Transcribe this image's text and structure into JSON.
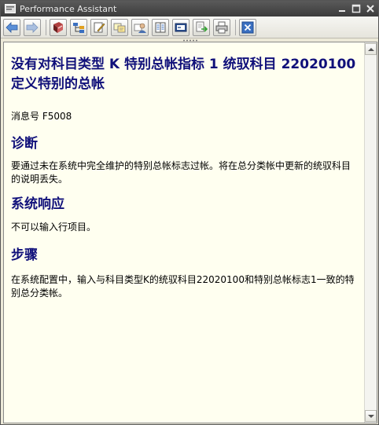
{
  "window": {
    "title": "Performance Assistant"
  },
  "toolbar": {
    "buttons": [
      {
        "name": "back-icon"
      },
      {
        "name": "forward-icon"
      },
      {
        "name": "book-icon"
      },
      {
        "name": "structure-icon"
      },
      {
        "name": "edit-icon"
      },
      {
        "name": "note-icon"
      },
      {
        "name": "user-icon"
      },
      {
        "name": "glossary-icon"
      },
      {
        "name": "display-icon"
      },
      {
        "name": "export-icon"
      },
      {
        "name": "print-icon"
      },
      {
        "name": "close-icon"
      }
    ]
  },
  "doc": {
    "title": "没有对科目类型 K 特别总帐指标 1 统驭科目 22020100 定义特别的总帐",
    "message_number": "消息号 F5008",
    "sections": [
      {
        "heading": "诊断",
        "text": "要通过未在系统中完全维护的特别总帐标志过帐。将在总分类帐中更新的统驭科目的说明丢失。"
      },
      {
        "heading": "系统响应",
        "text": "不可以输入行项目。"
      },
      {
        "heading": "步骤",
        "text": "在系统配置中，输入与科目类型K的统驭科目22020100和特别总帐标志1一致的特别总分类帐。"
      }
    ]
  },
  "colors": {
    "heading": "#10107a",
    "background": "#fffff0",
    "titlebar": "#4a4a4a"
  }
}
